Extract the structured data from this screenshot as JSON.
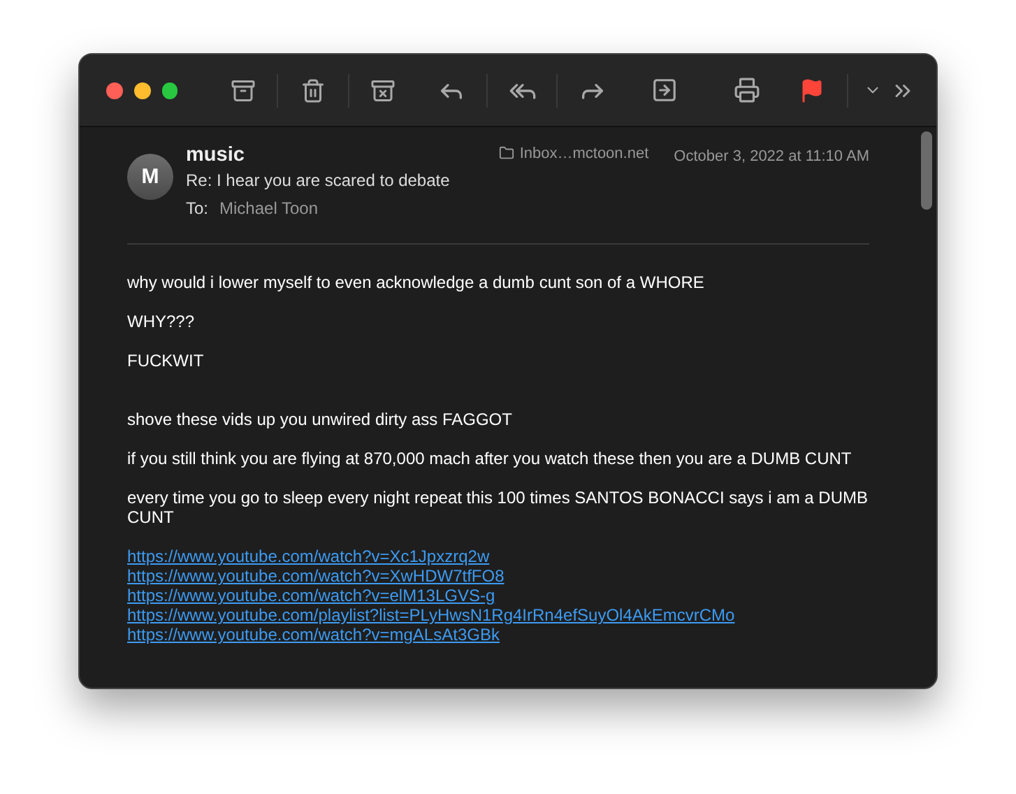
{
  "toolbar": {
    "flagged": true
  },
  "message": {
    "avatar_initial": "M",
    "sender": "music",
    "subject": "Re: I hear you are scared to debate",
    "to_label": "To:",
    "recipient": "Michael Toon",
    "mailbox": "Inbox…mctoon.net",
    "date": "October 3, 2022 at 11:10 AM"
  },
  "body": [
    {
      "kind": "paragraph",
      "text": "why would i lower myself to even acknowledge a dumb cunt son of a WHORE"
    },
    {
      "kind": "paragraph",
      "text": "WHY???"
    },
    {
      "kind": "paragraph",
      "text": "FUCKWIT"
    },
    {
      "kind": "spacer"
    },
    {
      "kind": "paragraph",
      "text": "shove these vids up you unwired dirty ass FAGGOT"
    },
    {
      "kind": "paragraph",
      "text": "if you still think you are flying at 870,000 mach after you watch these then you are a DUMB CUNT"
    },
    {
      "kind": "paragraph",
      "text": "every time you go to sleep every night repeat this 100 times SANTOS BONACCI says i am a DUMB CUNT"
    },
    {
      "kind": "links",
      "links": [
        "https://www.youtube.com/watch?v=Xc1Jpxzrq2w",
        "https://www.youtube.com/watch?v=XwHDW7tfFO8",
        "https://www.youtube.com/watch?v=elM13LGVS-g",
        "https://www.youtube.com/playlist?list=PLyHwsN1Rg4IrRn4efSuyOl4AkEmcvrCMo",
        "https://www.youtube.com/watch?v=mgALsAt3GBk"
      ]
    }
  ]
}
